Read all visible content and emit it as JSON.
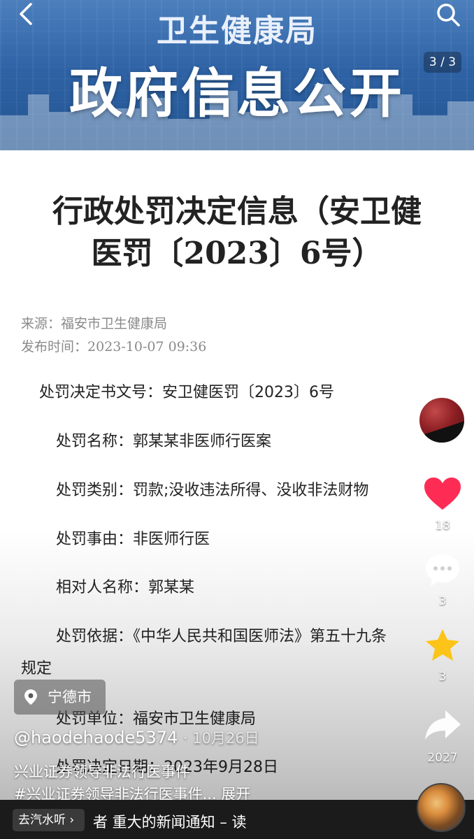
{
  "banner": {
    "subtitle": "卫生健康局",
    "title": "政府信息公开",
    "page_counter": "3 / 3"
  },
  "article": {
    "title_line1": "行政处罚决定信息（安卫健",
    "title_line2": "医罚〔2023〕6号）",
    "source_label": "来源：",
    "source_value": "福安市卫生健康局",
    "publish_label": "发布时间：",
    "publish_value": "2023-10-07 09:36",
    "fields": [
      "处罚决定书文号：安卫健医罚〔2023〕6号",
      "处罚名称：郭某某非医师行医案",
      "处罚类别：罚款;没收违法所得、没收非法财物",
      "处罚事由：非医师行医",
      "相对人名称：郭某某",
      "处罚依据：《中华人民共和国医师法》第五十九条",
      "规定",
      "处罚单位：福安市卫生健康局",
      "处罚决定日期：2023年9月28日"
    ]
  },
  "rail": {
    "likes": "18",
    "comments": "3",
    "favorites": "3",
    "shares": "2027"
  },
  "overlay": {
    "location": "宁德市",
    "author": "@haodehaode5374",
    "date": "10月26日",
    "video_title": "兴业证券领导非法行医事件",
    "hashtag": "#兴业证券领导非法行医事件...",
    "expand": "展开",
    "music_chip": "去汽水听",
    "music_text": "者    重大的新闻通知  – 读"
  },
  "colors": {
    "banner_blue": "#2f63a6",
    "like_red": "#fe2c55",
    "favorite_yellow": "#fcc419"
  }
}
